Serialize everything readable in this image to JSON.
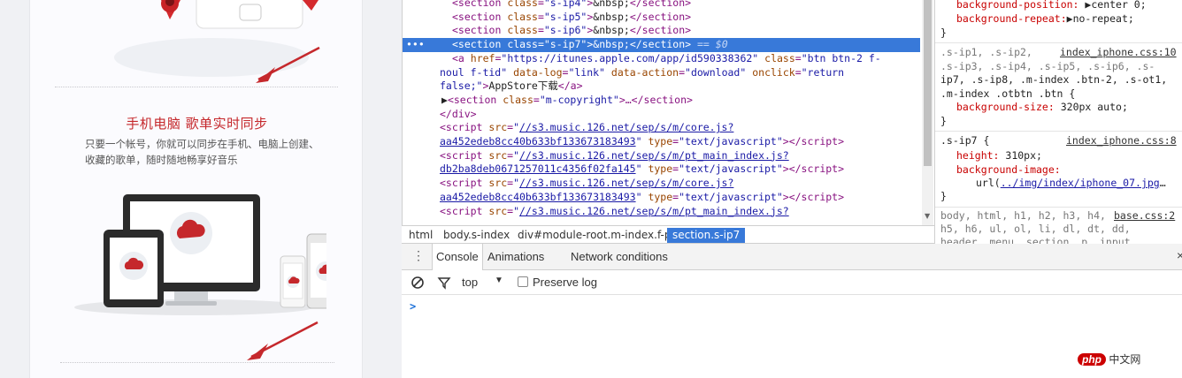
{
  "preview": {
    "section_title": "手机电脑 歌单实时同步",
    "section_desc": "只要一个帐号，你就可以同步在手机、电脑上创建、收藏的歌单，随时随地畅享好音乐"
  },
  "elements": {
    "lines": [
      {
        "kind": "section",
        "cls": "s-ip4",
        "text": "&nbsp;"
      },
      {
        "kind": "section",
        "cls": "s-ip5",
        "text": "&nbsp;"
      },
      {
        "kind": "section",
        "cls": "s-ip6",
        "text": "&nbsp;"
      },
      {
        "kind": "section",
        "cls": "s-ip7",
        "text": "&nbsp;",
        "selected": true,
        "suffix": " == $0"
      }
    ],
    "anchor": {
      "href": "https://itunes.apple.com/app/id590338362",
      "cls": "btn btn-2 f-noul f-tid",
      "log": "link",
      "action": "download",
      "onclick": "return false;",
      "text": "AppStore下载"
    },
    "copyright_cls": "m-copyright",
    "scripts": [
      {
        "src1": "//s3.music.126.net/sep/s/m/core.js?",
        "src2": "aa452edeb8cc40b633bf133673183493",
        "type": "text/javascript"
      },
      {
        "src1": "//s3.music.126.net/sep/s/m/pt_main_index.js?",
        "src2": "db2ba8deb0671257011c4356f02fa145",
        "type": "text/javascript"
      },
      {
        "src1": "//s3.music.126.net/sep/s/m/core.js?",
        "src2": "aa452edeb8cc40b633bf133673183493",
        "type": "text/javascript"
      },
      {
        "src1": "//s3.music.126.net/sep/s/m/pt_main_index.js?",
        "src2": "",
        "type": ""
      }
    ]
  },
  "breadcrumb": [
    "html",
    "body.s-index",
    "div#module-root.m-index.f-pr",
    "section.s-ip7"
  ],
  "styles": {
    "bg_position": "background-position:",
    "bg_position_val": "center 0;",
    "bg_repeat": "background-repeat:",
    "bg_repeat_val": "no-repeat;",
    "rule1_selectors": [
      ".s-ip1, .s-ip2,",
      ".s-ip3, .s-ip4, .s-ip5, .s-ip6, .s-",
      "ip7, .s-ip8, .m-index .btn-2, .s-ot1,",
      ".m-index .otbtn .btn {"
    ],
    "rule1_source": "index_iphone.css:10",
    "rule1_prop": "background-size:",
    "rule1_val": "320px auto;",
    "rule2_selector": ".s-ip7 {",
    "rule2_source": "index_iphone.css:8",
    "rule2_prop1": "height:",
    "rule2_val1": "310px;",
    "rule2_prop2": "background-image:",
    "rule2_url": "../img/index/iphone_07.jpg",
    "rule3_selectors": [
      "body, html, h1, h2, h3, h4,",
      "h5, h6, ul, ol, li, dl, dt, dd,",
      "header, menu, section, p, input,"
    ],
    "rule3_source": "base.css:2"
  },
  "drawer": {
    "tabs": [
      "Console",
      "Animations",
      "Network conditions"
    ],
    "context": "top",
    "preserve_log": "Preserve log",
    "prompt": ">"
  },
  "watermark": "中文网",
  "watermark_brand": "php"
}
